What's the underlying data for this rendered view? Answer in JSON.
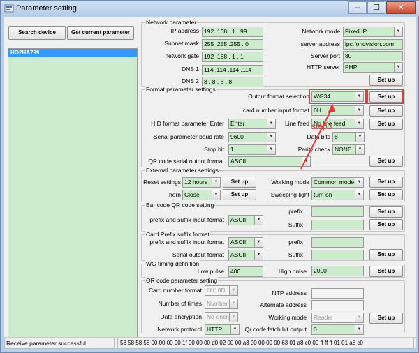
{
  "window": {
    "title": "Parameter setting",
    "minimize": "–",
    "maximize": "☐",
    "close": "✕"
  },
  "left": {
    "search_device": "Search device",
    "get_current": "Get current parameter",
    "devices": [
      "HO2HA799"
    ]
  },
  "network": {
    "title": "Network parameter",
    "ip_label": "IP address",
    "ip": "192 .168 .  1  . 99",
    "mask_label": "Subnet mask",
    "mask": "255 .255 .255 .  0",
    "gate_label": "network gate",
    "gate": "192 .168 .  1  .  1",
    "dns1_label": "DNS 1",
    "dns1": "114 .114 .114 .114",
    "dns2_label": "DNS 2",
    "dns2": "8  .  8  .  8  .  8",
    "mode_label": "Network mode",
    "mode": "Fixed IP",
    "server_label": "server address",
    "server": "ipc.fondvision.com",
    "port_label": "Server port",
    "port": "80",
    "http_label": "HTTP server",
    "http": "PHP",
    "setup": "Set up"
  },
  "format": {
    "title": "Format parameter settings",
    "output_label": "Output format selection",
    "output": "WG34",
    "card_label": "card number input format",
    "card": "6H",
    "hid_label": "HID format parameter  Enter",
    "hid": "Enter",
    "linefeed_label": "Line feed",
    "linefeed": "No line feed",
    "baud_label": "Serial parameter baud rate",
    "baud": "9600",
    "databits_label": "Data bits",
    "databits": "8",
    "stopbit_label": "Stop bit",
    "stopbit": "1",
    "parity_label": "Parity check",
    "parity": "NONE",
    "qr_label": "QR code serial output format",
    "qr": "ASCII",
    "setup": "Set up",
    "step": "step3"
  },
  "external": {
    "title": "External parameter settings",
    "reset_label": "Reset settings",
    "reset": "12 hours",
    "horn_label": "horn",
    "horn": "Close",
    "working_label": "Working mode",
    "working": "Common mode",
    "sweeping_label": "Sweeping light",
    "sweeping": "turn on",
    "setup": "Set up"
  },
  "barcode": {
    "title": "Bar code QR code setting",
    "input_label": "prefix and suffix input format",
    "input": "ASCII",
    "prefix_label": "prefix",
    "prefix": "",
    "suffix_label": "Suffix",
    "suffix": "",
    "setup": "Set up"
  },
  "cardprefix": {
    "title": "Card Prefix suffix format",
    "input_label": "prefix and suffix input format",
    "input": "ASCII",
    "serial_label": "Serial output format",
    "serial": "ASCII",
    "prefix_label": "prefix",
    "prefix": "",
    "suffix_label": "Suffix",
    "suffix": "",
    "setup": "Set up"
  },
  "wg": {
    "title": "WG timing definition",
    "low_label": "Low pulse",
    "low": "400",
    "high_label": "High pulse",
    "high": "2000",
    "setup": "Set up"
  },
  "qrparam": {
    "title": "QR code parameter setting",
    "cardfmt_label": "Card number format",
    "cardfmt": "8H10D",
    "times_label": "Number of times",
    "times": "Number",
    "encrypt_label": "Data encryption",
    "encrypt": "No-encry",
    "protocol_label": "Network protocol",
    "protocol": "HTTP",
    "ntp_label": "NTP address",
    "ntp": "",
    "alt_label": "Alternate address",
    "alt": "",
    "mode_label": "Working mode",
    "mode": "Reader",
    "fetch_label": "Qr code fetch bit output",
    "fetch": "0",
    "setup": "Set up"
  },
  "status": {
    "message": "Receive parameter successful",
    "hex": "58 58 58 58 00 00 00 00 1f 00 00 00 d0 02 00 00 a3 00 00 00 00 63 01 a8 c0 00 ff ff ff 01 01 a8 c0"
  },
  "colors": {
    "field_bg": "#cdeccd",
    "selection": "#3399ff",
    "highlight": "#e23b3b"
  }
}
